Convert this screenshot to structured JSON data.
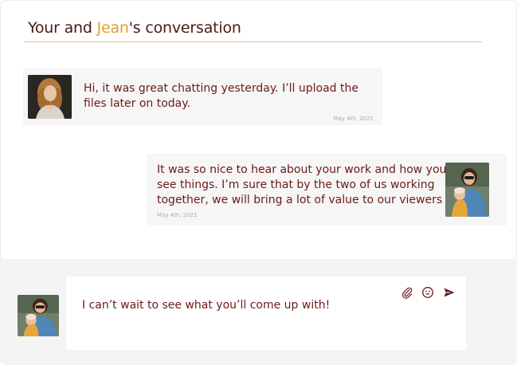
{
  "header": {
    "title_prefix": "Your and ",
    "title_name": "Jean",
    "title_suffix": "'s conversation"
  },
  "messages": [
    {
      "direction": "incoming",
      "avatar_icon": "avatar-woman-curly-hair",
      "text_line1": "Hi, it was great chatting yesterday. I’ll upload the",
      "text_line2": "files later on today.",
      "date": "May 4th, 2021"
    },
    {
      "direction": "outgoing",
      "avatar_icon": "avatar-woman-with-child",
      "text_line1": "It was so nice to hear about your work and how you",
      "text_line2": "see things. I’m sure that by the two of us working",
      "text_line3": "together, we will bring a lot of value to our viewers",
      "date": "May 4th, 2021"
    }
  ],
  "composer": {
    "value": "I can’t wait to see what you’ll come up with!",
    "avatar_icon": "avatar-woman-with-child",
    "tools": [
      "paperclip-icon",
      "emoji-icon",
      "send-icon"
    ]
  },
  "colors": {
    "accent": "#e0a02c",
    "title_text": "#4a1616",
    "message_text": "#6b1a1a",
    "bubble_bg": "#f6f6f6",
    "composer_bg": "#f4f4f4"
  }
}
